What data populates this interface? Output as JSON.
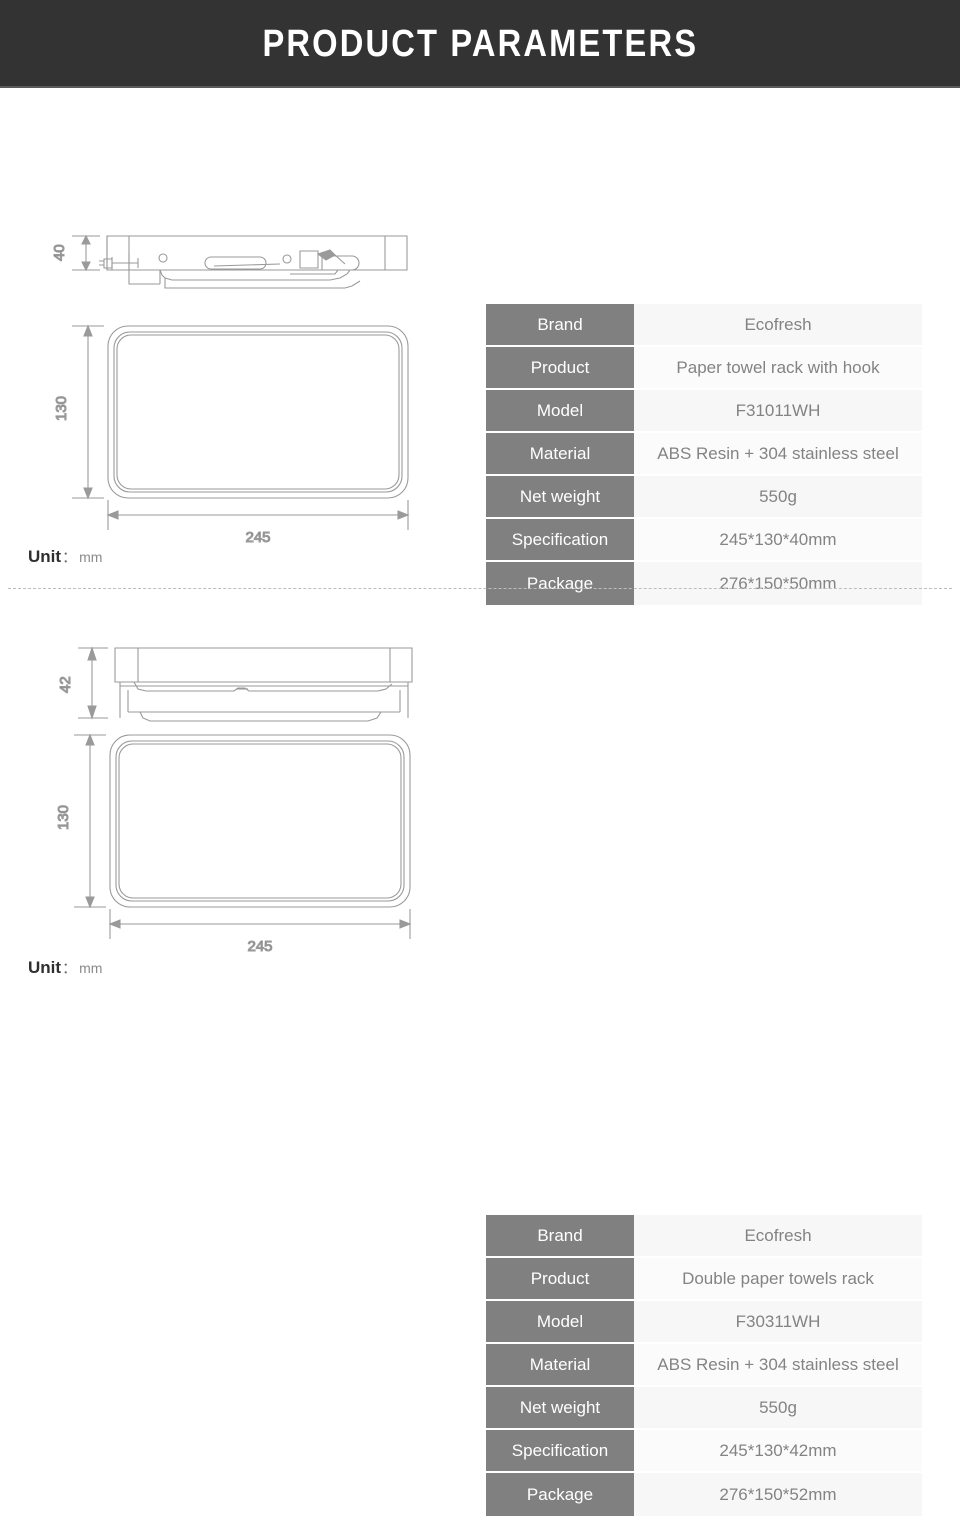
{
  "header": {
    "title": "PRODUCT PARAMETERS"
  },
  "sections": [
    {
      "id": "section-1",
      "drawing": {
        "height_dim": "40",
        "depth_dim": "130",
        "width_dim": "245",
        "unit_label": "Unit",
        "unit_separator": "：",
        "unit_value": "mm"
      },
      "table": {
        "rows": [
          {
            "label": "Brand",
            "value": "Ecofresh"
          },
          {
            "label": "Product",
            "value": "Paper towel rack with hook"
          },
          {
            "label": "Model",
            "value": "F31011WH"
          },
          {
            "label": "Material",
            "value": "ABS Resin + 304 stainless steel"
          },
          {
            "label": "Net weight",
            "value": "550g"
          },
          {
            "label": "Specification",
            "value": "245*130*40mm"
          },
          {
            "label": "Package",
            "value": "276*150*50mm"
          }
        ]
      }
    },
    {
      "id": "section-2",
      "drawing": {
        "height_dim": "42",
        "depth_dim": "130",
        "width_dim": "245",
        "unit_label": "Unit",
        "unit_separator": "：",
        "unit_value": "mm"
      },
      "table": {
        "rows": [
          {
            "label": "Brand",
            "value": "Ecofresh"
          },
          {
            "label": "Product",
            "value": "Double paper towels rack"
          },
          {
            "label": "Model",
            "value": "F30311WH"
          },
          {
            "label": "Material",
            "value": "ABS Resin + 304 stainless steel"
          },
          {
            "label": "Net weight",
            "value": "550g"
          },
          {
            "label": "Specification",
            "value": "245*130*42mm"
          },
          {
            "label": "Package",
            "value": "276*150*52mm"
          }
        ]
      }
    }
  ],
  "colors": {
    "banner_background": "#333333",
    "banner_text": "#ffffff",
    "label_cell": "#808080",
    "label_text": "#ffffff",
    "value_cell": "#f7f7f7",
    "value_text": "#838383",
    "drawing_line": "#9a9a9a",
    "divider": "#bdbdbd"
  }
}
